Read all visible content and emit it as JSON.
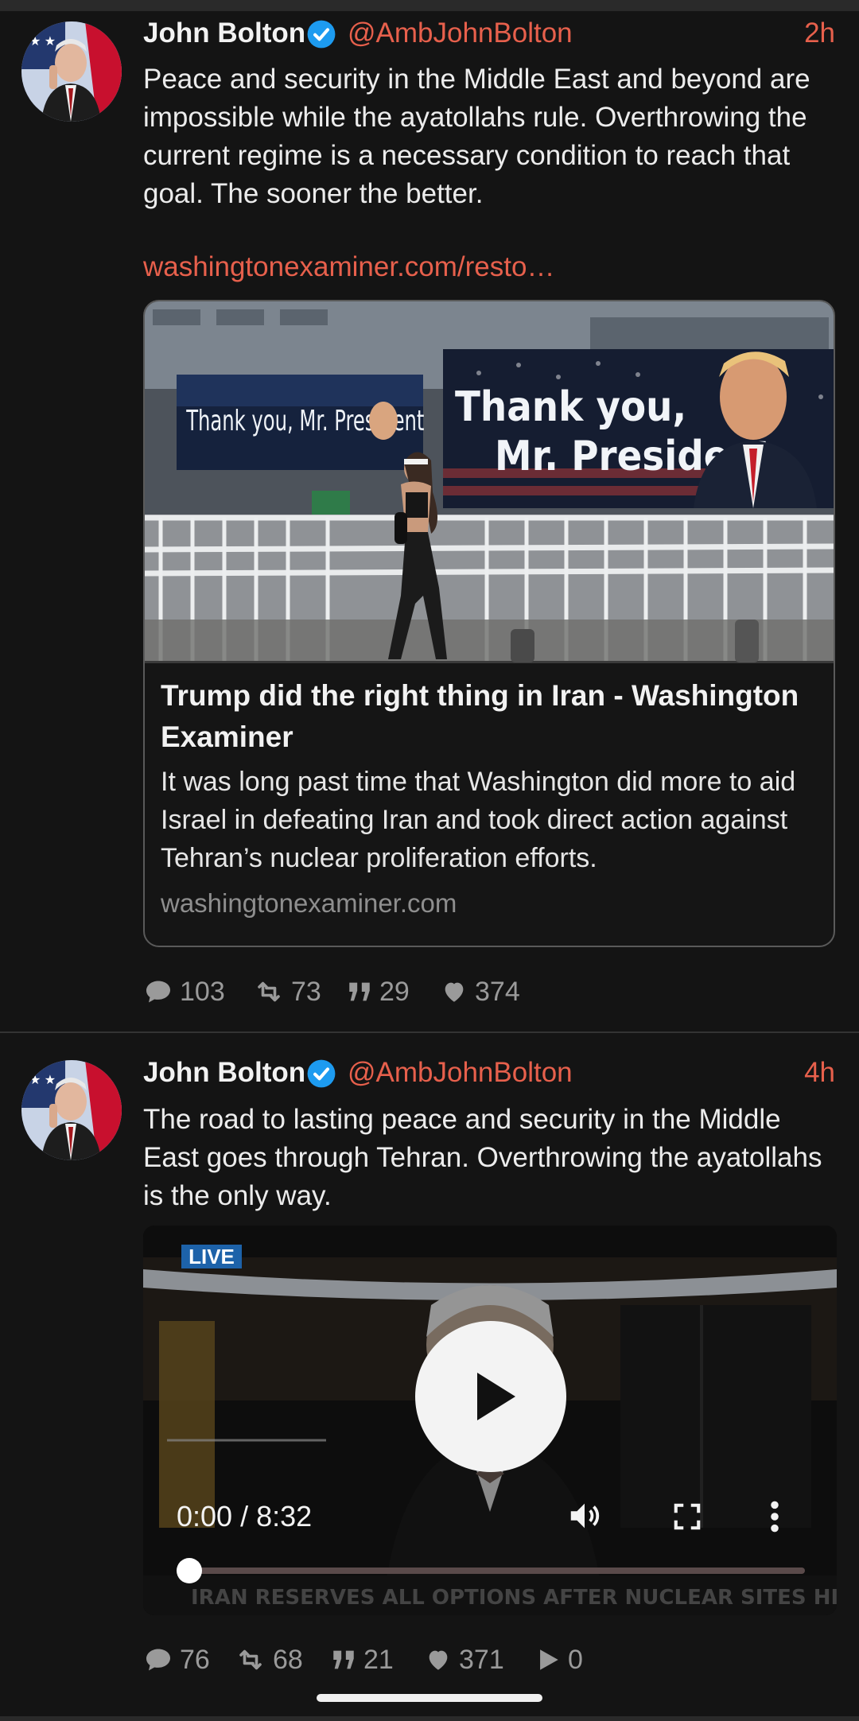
{
  "colors": {
    "accent": "#e7604c",
    "verified": "#1d9bf0",
    "background": "#141414"
  },
  "tweets": [
    {
      "name": "John Bolton",
      "handle": "@AmbJohnBolton",
      "time": "2h",
      "text": "Peace and security in the Middle East and beyond are impossible while the ayatollahs rule. Overthrowing the current regime is a necessary condition to reach that goal. The sooner the better.",
      "link": "washingtonexaminer.com/resto…",
      "card": {
        "image_text_left": "Thank you, Mr. President",
        "image_text_right_1": "Thank you,",
        "image_text_right_2": "Mr. President",
        "title": "Trump did the right thing in Iran - Washington Examiner",
        "description": "It was long past time that Washington did more to aid Israel in defeating Iran and took direct action against Tehran’s nuclear proliferation efforts.",
        "domain": "washingtonexaminer.com"
      },
      "replies": "103",
      "reposts": "73",
      "quotes": "29",
      "likes": "374"
    },
    {
      "name": "John Bolton",
      "handle": "@AmbJohnBolton",
      "time": "4h",
      "text": "The road to lasting peace and security in the Middle East goes through Tehran. Overthrowing the ayatollahs is the only way.",
      "video": {
        "live_label": "LIVE",
        "time": "0:00 / 8:32",
        "progress": 0,
        "ticker": "IRAN RESERVES ALL OPTIONS AFTER NUCLEAR SITES HIT"
      },
      "replies": "76",
      "reposts": "68",
      "quotes": "21",
      "likes": "371",
      "plays": "0"
    }
  ]
}
